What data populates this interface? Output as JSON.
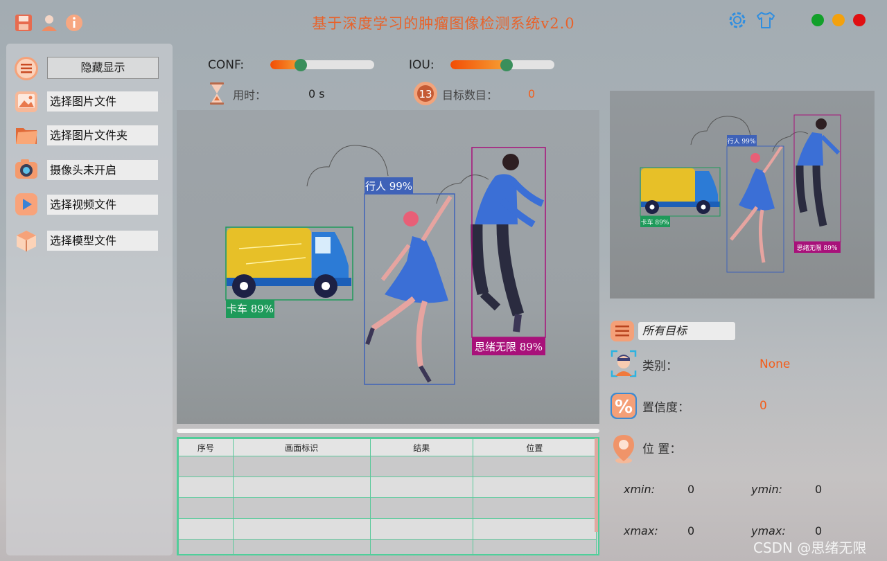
{
  "titlebar": {
    "title": "基于深度学习的肿瘤图像检测系统v2.0",
    "left_icons": [
      "save-icon",
      "user-icon",
      "info-icon"
    ],
    "right_icons": [
      "settings-gear-icon",
      "tshirt-theme-icon"
    ],
    "window_dots": [
      "#12a02a",
      "#f3a10d",
      "#e00f12"
    ]
  },
  "sidebar": {
    "hide_button": "隐藏显示",
    "items": [
      {
        "label": "选择图片文件",
        "icon": "image-file-icon"
      },
      {
        "label": "选择图片文件夹",
        "icon": "folder-icon"
      },
      {
        "label": "摄像头未开启",
        "icon": "camera-icon"
      },
      {
        "label": "选择视频文件",
        "icon": "video-play-icon"
      },
      {
        "label": "选择模型文件",
        "icon": "model-box-icon"
      }
    ]
  },
  "controls": {
    "conf_label": "CONF:",
    "conf_value": 0.29,
    "iou_label": "IOU:",
    "iou_value": 0.54
  },
  "stats": {
    "time_label": "用时：",
    "time_value": "0 s",
    "count_label": "目标数目：",
    "count_value": "0"
  },
  "detections": {
    "labels": [
      "卡车 89%",
      "行人 99%",
      "思绪无限 89%"
    ],
    "colors": [
      "#1e9a5a",
      "#3f62b8",
      "#a8117a"
    ]
  },
  "table": {
    "headers": [
      "序号",
      "画面标识",
      "结果",
      "位置"
    ],
    "row_count": 5
  },
  "info": {
    "filter_value": "所有目标",
    "class_label": "类别：",
    "class_value": "None",
    "conf_label": "置信度：",
    "conf_value": "0",
    "pos_label": "位 置：",
    "xmin_label": "xmin:",
    "xmin_value": "0",
    "ymin_label": "ymin:",
    "ymin_value": "0",
    "xmax_label": "xmax:",
    "xmax_value": "0",
    "ymax_label": "ymax:",
    "ymax_value": "0"
  },
  "watermark": "CSDN @思绪无限"
}
